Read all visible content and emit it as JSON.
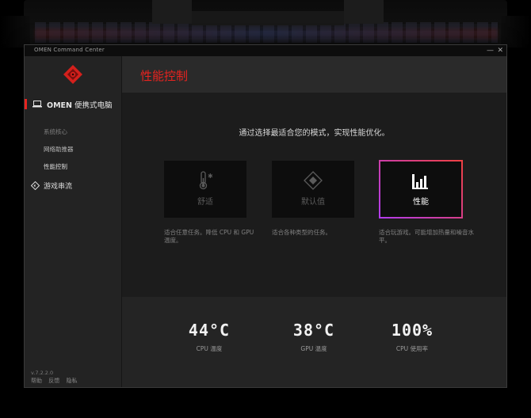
{
  "window": {
    "title": "OMEN Command Center",
    "minimize": "—",
    "close": "✕"
  },
  "sidebar": {
    "main_item": {
      "brand": "OMEN",
      "label": "便携式电脑"
    },
    "sub_items": [
      "系统核心",
      "网络助推器",
      "性能控制"
    ],
    "stream_item": "游戏串流",
    "version": "v.7.2.2.0",
    "footer": [
      "帮助",
      "反馈",
      "隐私"
    ]
  },
  "main": {
    "title": "性能控制",
    "subtitle": "通过选择最适合您的模式，实现性能优化。",
    "modes": [
      {
        "name": "舒适",
        "description": "适合任意任务。降低 CPU 和 GPU 温度。",
        "icon": "thermometer-icon"
      },
      {
        "name": "默认值",
        "description": "适合各种类型的任务。",
        "icon": "diamond-icon"
      },
      {
        "name": "性能",
        "description": "适合玩游戏。可能增加热量和噪音水平。",
        "icon": "bars-icon",
        "selected": true
      }
    ],
    "stats": [
      {
        "value": "44°C",
        "label": "CPU 温度"
      },
      {
        "value": "38°C",
        "label": "GPU 温度"
      },
      {
        "value": "100%",
        "label": "CPU 使用率"
      }
    ]
  },
  "colors": {
    "accent": "#e8231f",
    "gradient_start": "#f04040",
    "gradient_end": "#b23cf0"
  }
}
